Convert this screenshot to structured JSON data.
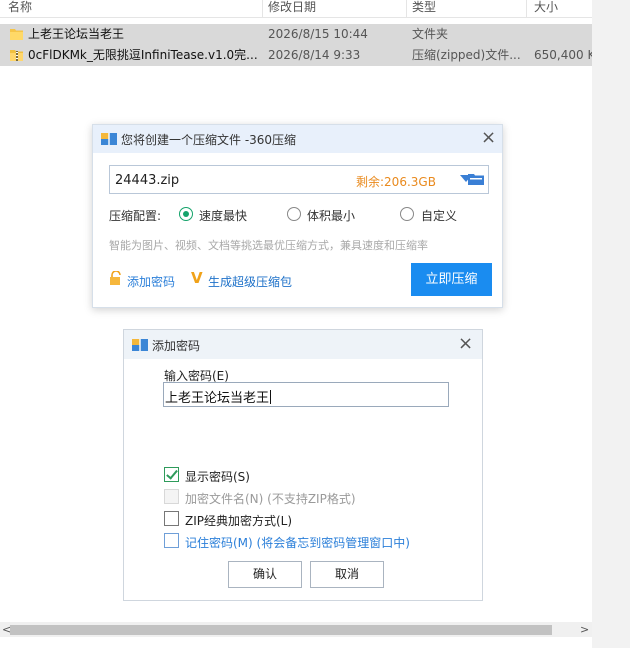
{
  "explorer": {
    "columns": {
      "name": "名称",
      "modified": "修改日期",
      "type": "类型",
      "size": "大小"
    },
    "files": [
      {
        "name": "上老王论坛当老王",
        "modified": "2026/8/15 10:44",
        "type": "文件夹",
        "size": "",
        "icon": "folder-icon"
      },
      {
        "name": "0cFlDKMk_无限挑逗InfiniTease.v1.0完...",
        "modified": "2026/8/14 9:33",
        "type": "压缩(zipped)文件...",
        "size": "650,400 K",
        "icon": "zip-file-icon"
      }
    ],
    "hscroll": {
      "left_arrow": "<",
      "right_arrow": ">"
    }
  },
  "compress_dialog": {
    "title": "您将创建一个压缩文件 -360压缩",
    "close": "×",
    "filename": "24443.zip",
    "free_space": "剩余:206.3GB",
    "config_label": "压缩配置:",
    "options": [
      {
        "label": "速度最快",
        "selected": true
      },
      {
        "label": "体积最小",
        "selected": false
      },
      {
        "label": "自定义",
        "selected": false
      }
    ],
    "hint": "智能为图片、视频、文档等挑选最优压缩方式，兼具速度和压缩率",
    "add_password": "添加密码",
    "super_package_prefix": "生成",
    "super_package_suffix": "超级压缩包",
    "compress_now": "立即压缩",
    "colors": {
      "accent": "#1a8cf0",
      "free_space": "#e98a1e",
      "title_bg": "#e8f0fb"
    }
  },
  "password_dialog": {
    "title": "添加密码",
    "close": "×",
    "input_label": "输入密码(E)",
    "password_value": "上老王论坛当老王",
    "checkboxes": [
      {
        "label": "显示密码(S)",
        "checked": true,
        "enabled": true
      },
      {
        "label": "加密文件名(N) (不支持ZIP格式)",
        "checked": false,
        "enabled": false
      },
      {
        "label": "ZIP经典加密方式(L)",
        "checked": false,
        "enabled": true
      },
      {
        "label": "记住密码(M) (将会备忘到密码管理窗口中)",
        "checked": false,
        "enabled": true
      }
    ],
    "ok": "确认",
    "cancel": "取消"
  }
}
